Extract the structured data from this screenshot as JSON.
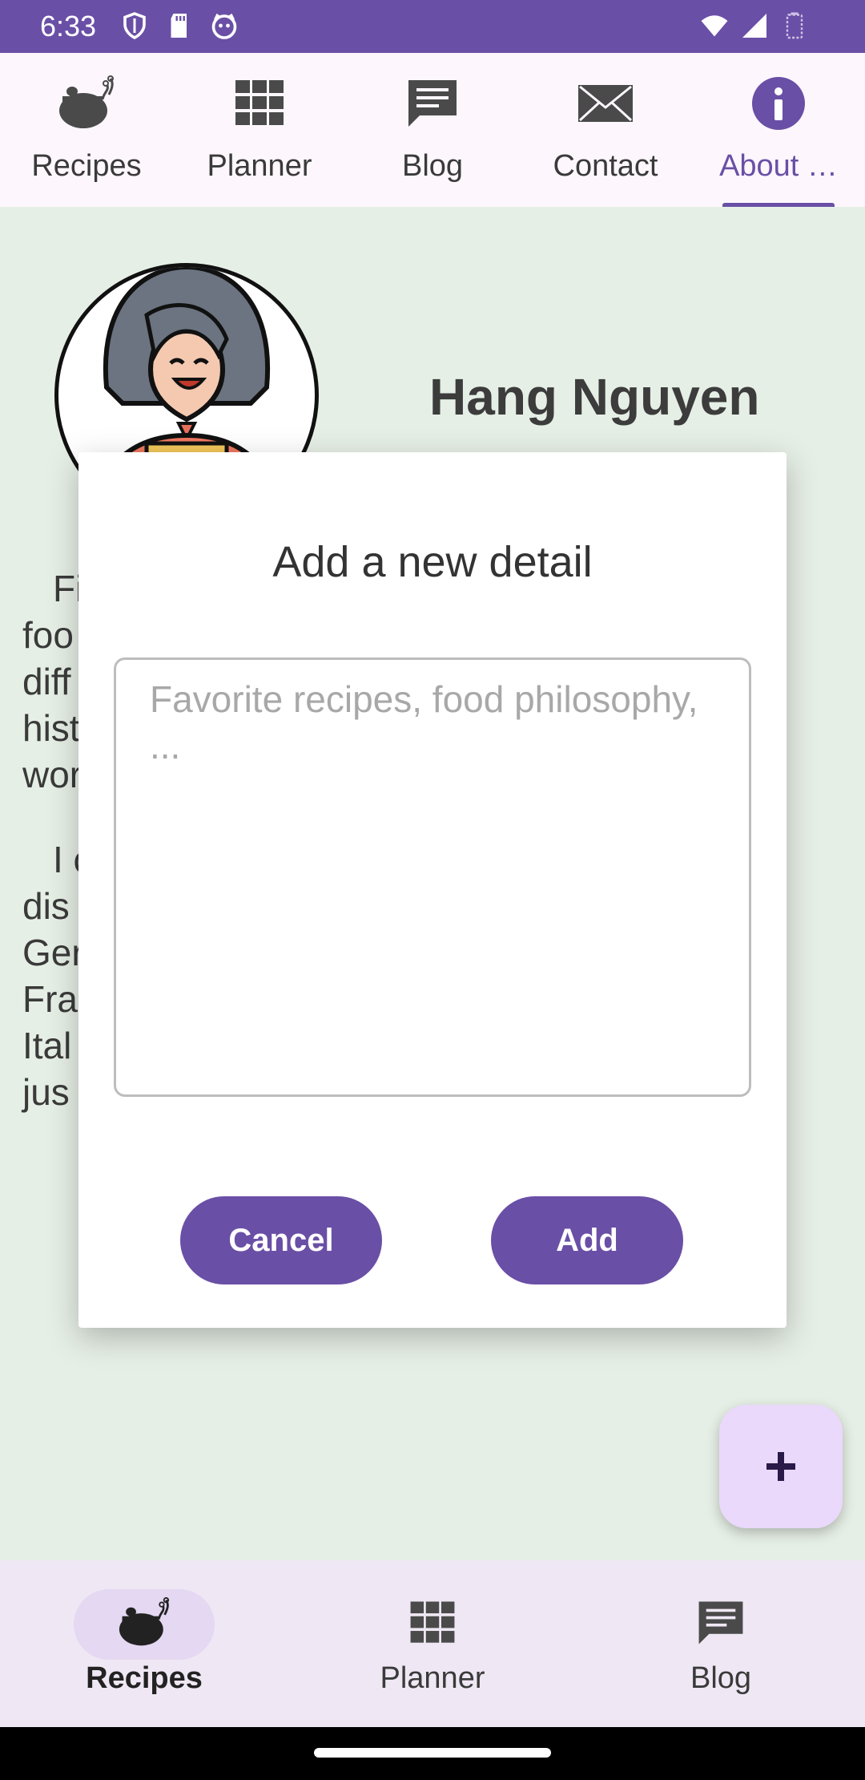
{
  "status_bar": {
    "time": "6:33",
    "left_icons": [
      "shield-icon",
      "sd-card-icon",
      "cat-face-icon"
    ],
    "right_icons": [
      "wifi-icon",
      "signal-icon",
      "battery-icon"
    ],
    "color": "#6a4fa6"
  },
  "top_tabs": [
    {
      "label": "Recipes",
      "icon": "pot-icon"
    },
    {
      "label": "Planner",
      "icon": "grid-icon"
    },
    {
      "label": "Blog",
      "icon": "chat-icon"
    },
    {
      "label": "Contact",
      "icon": "mail-icon"
    },
    {
      "label": "About …",
      "icon": "info-icon",
      "active": true
    }
  ],
  "profile": {
    "name": "Hang Nguyen",
    "avatar": "chef-avatar-icon"
  },
  "bio": {
    "para1_visible": "Fi foo diff hist wor",
    "para2_visible": "I c dis Ger Fra Ital jus"
  },
  "dialog": {
    "title": "Add a new detail",
    "input_placeholder": "Favorite recipes, food philosophy, ...",
    "input_value": "",
    "cancel_label": "Cancel",
    "add_label": "Add"
  },
  "fab": {
    "icon": "plus-icon"
  },
  "bottom_nav": [
    {
      "label": "Recipes",
      "icon": "pot-icon",
      "active": true
    },
    {
      "label": "Planner",
      "icon": "grid-icon"
    },
    {
      "label": "Blog",
      "icon": "chat-icon"
    }
  ],
  "colors": {
    "accent": "#6a4fa6",
    "background": "#e6efe6",
    "fab": "#ead9fb"
  }
}
